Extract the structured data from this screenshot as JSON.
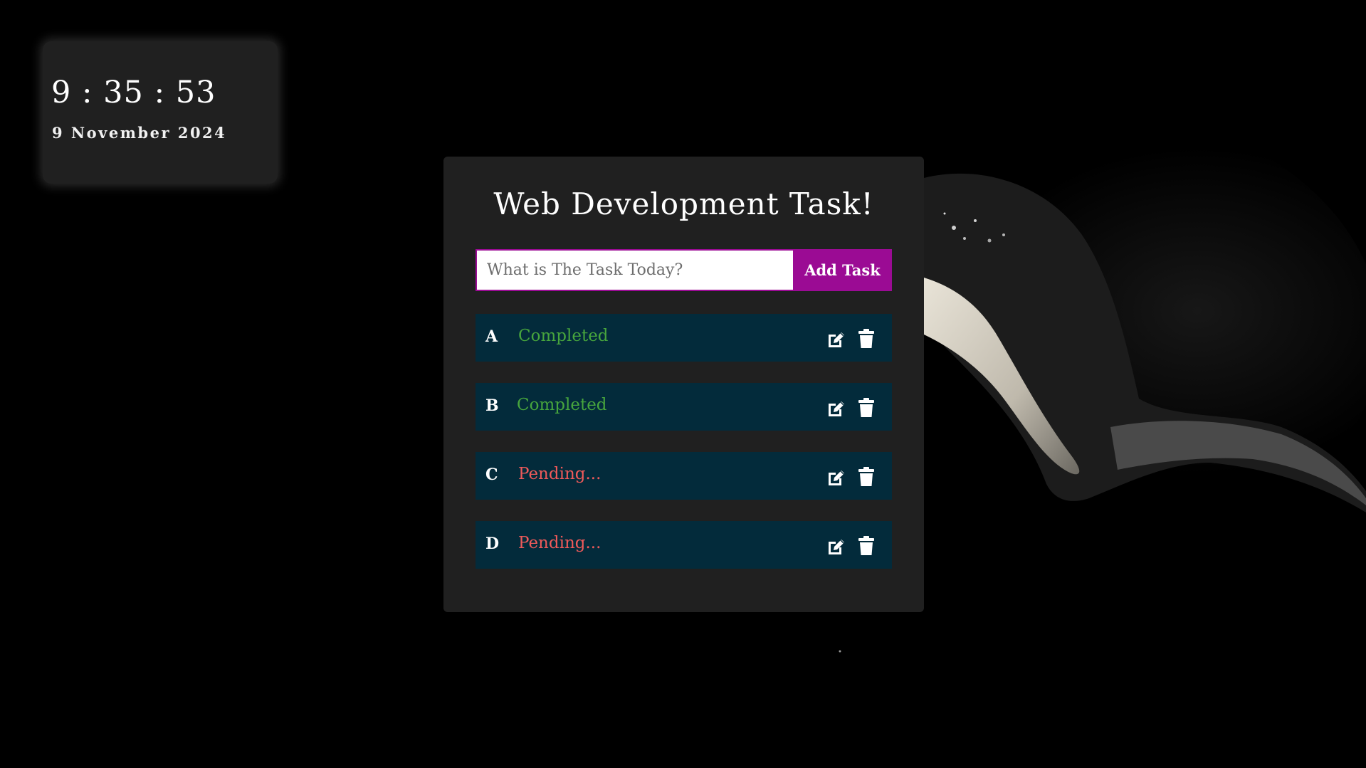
{
  "clock": {
    "time": "9 : 35 : 53",
    "date": "9 November 2024"
  },
  "panel": {
    "title": "Web Development Task!"
  },
  "input": {
    "placeholder": "What is The Task Today?",
    "value": ""
  },
  "add_button": {
    "label": "Add Task"
  },
  "tasks": [
    {
      "name": "A",
      "status": "Completed",
      "state": "completed"
    },
    {
      "name": "B",
      "status": "Completed",
      "state": "completed"
    },
    {
      "name": "C",
      "status": "Pending...",
      "state": "pending"
    },
    {
      "name": "D",
      "status": "Pending...",
      "state": "pending"
    }
  ],
  "icons": {
    "edit": "edit-icon",
    "delete": "trash-icon"
  },
  "colors": {
    "background": "#000000",
    "panel": "#202020",
    "accent": "#9b0b94",
    "task_row": "#032b3b",
    "completed": "#47a53d",
    "pending": "#ef5a5a"
  }
}
